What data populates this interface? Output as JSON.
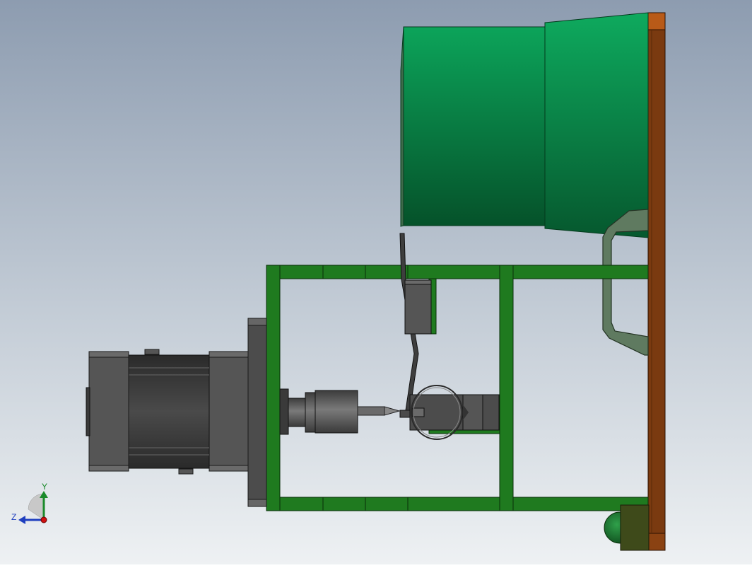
{
  "triad": {
    "y_label": "Y",
    "z_label": "Z",
    "y_color": "#1a8a2a",
    "z_color": "#1f3fbf",
    "x_color": "#d01010"
  },
  "colors": {
    "background_top": "#8e9db0",
    "background_bottom": "#eef1f3",
    "frame_green": "#1f7a1f",
    "frame_green_dark": "#0c3a0c",
    "drum_green": "#0c9a50",
    "drum_green_dark": "#055a2e",
    "plate_brown": "#7a3a10",
    "motor_gray": "#4a4a4a",
    "motor_dark": "#2e2e2e"
  },
  "parts": {
    "frame": "welded-steel-frame",
    "motor": "electric-motor",
    "coupling": "shaft-coupling",
    "drum": "conical-drum",
    "plate": "mounting-plate",
    "wheel": "caster-wheel",
    "arm": "pivot-arm",
    "bracket": "side-bracket"
  }
}
